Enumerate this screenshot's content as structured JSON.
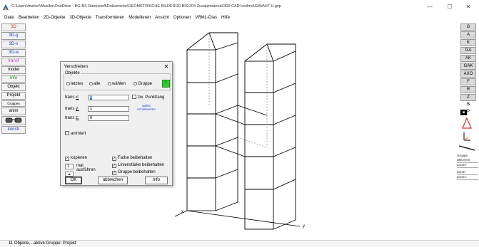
{
  "window": {
    "title": "C:\\Users\\markel\\Mueller\\OneDrive - BG-BS Datenstoff\\Dokumente\\GEOMETRISCHE BILDER\\20 BIS\\203 Zusatzmaterial\\300 CAD konkret\\GAM\\H7 H.gxp",
    "minimize": "—",
    "maximize": "☐",
    "close": "✕"
  },
  "menu": [
    "Datei",
    "Bearbeiten",
    "2D-Objekte",
    "3D-Objekte",
    "Transformieren",
    "Modellieren",
    "Ansicht",
    "Optionen",
    "VRML-Dias",
    "Hilfe"
  ],
  "left_toolbar": [
    {
      "label": "3D",
      "color": "#e03030"
    },
    {
      "label": "3D-g",
      "color": "#2040d0"
    },
    {
      "label": "3D-s",
      "color": "#2040d0"
    },
    {
      "label": "3D-w",
      "color": "#2040d0"
    },
    {
      "label": "transf",
      "color": "#d030d0"
    },
    {
      "label": "model",
      "color": "#000000"
    },
    {
      "label": "Info",
      "color": "#109010"
    },
    {
      "label": "Objekt",
      "color": "#000000"
    },
    {
      "label": "Projekt",
      "color": "#000000"
    },
    {
      "label": "Gruppen",
      "color": "#000000"
    },
    {
      "label": "anim",
      "color": "#000000"
    },
    {
      "label": "konstr",
      "color": "#2040d0"
    }
  ],
  "right_toolbar": {
    "buttons": [
      "G",
      "A",
      "K",
      "GA",
      "AK",
      "GAK",
      "AXO",
      "F",
      "R",
      "Z"
    ],
    "s_label": "S",
    "p_label": "P",
    "small": [
      "Gruppe akti.ieren",
      "Zoom+",
      "Zoom-",
      "Zoom="
    ]
  },
  "dialog": {
    "title": "Verschieben",
    "close": "✕",
    "group_label": "Objekte",
    "radios": [
      "letztes",
      "alle",
      "wählen",
      "Gruppe"
    ],
    "green_btn": "!",
    "trans_x_label": "trans",
    "trans_x_axis": "x:",
    "trans_x_value": "0",
    "trans_y_label": "trans",
    "trans_y_axis": "y:",
    "trans_y_value": "1",
    "trans_z_label": "trans",
    "trans_z_axis": "z:",
    "trans_z_value": "0",
    "zw_punkt": "zw. Punkt/ang",
    "blue_link": "wähle Schiebvektor",
    "animiert": "animiert",
    "kopieren": "kopieren",
    "mal_value": "1",
    "mal_ausfuehren": "mal ausführen",
    "farbe": "Farbe beibehalten",
    "linienstaerke": "Linienstärke beibehalten",
    "gruppe": "Gruppe beibehalten",
    "ok": "OK",
    "abbrechen": "abbrechen",
    "info": "Info"
  },
  "axes": {
    "x": "x",
    "y": "y"
  },
  "status": "11 Objekte,...aktive Gruppe: Projekt"
}
